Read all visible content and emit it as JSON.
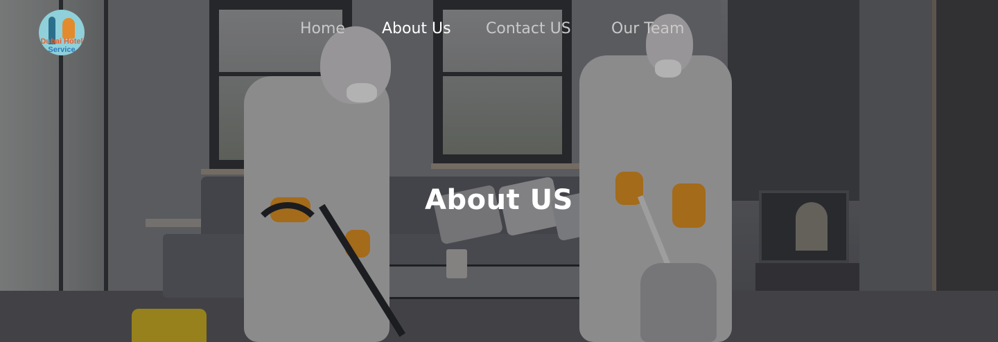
{
  "header": {
    "logo": {
      "icon": "burj-tower-and-worker-logo-icon",
      "text_line1": "Dubai Hotel",
      "text_line2": "Service"
    },
    "nav": [
      {
        "label": "Home",
        "active": false
      },
      {
        "label": "About Us",
        "active": true
      },
      {
        "label": "Contact US",
        "active": false
      },
      {
        "label": "Our Team",
        "active": false
      }
    ]
  },
  "hero": {
    "heading": "About US"
  },
  "colors": {
    "nav_active": "#ffffff",
    "nav_inactive": "#c9c9c9",
    "heading": "#ffffff"
  }
}
